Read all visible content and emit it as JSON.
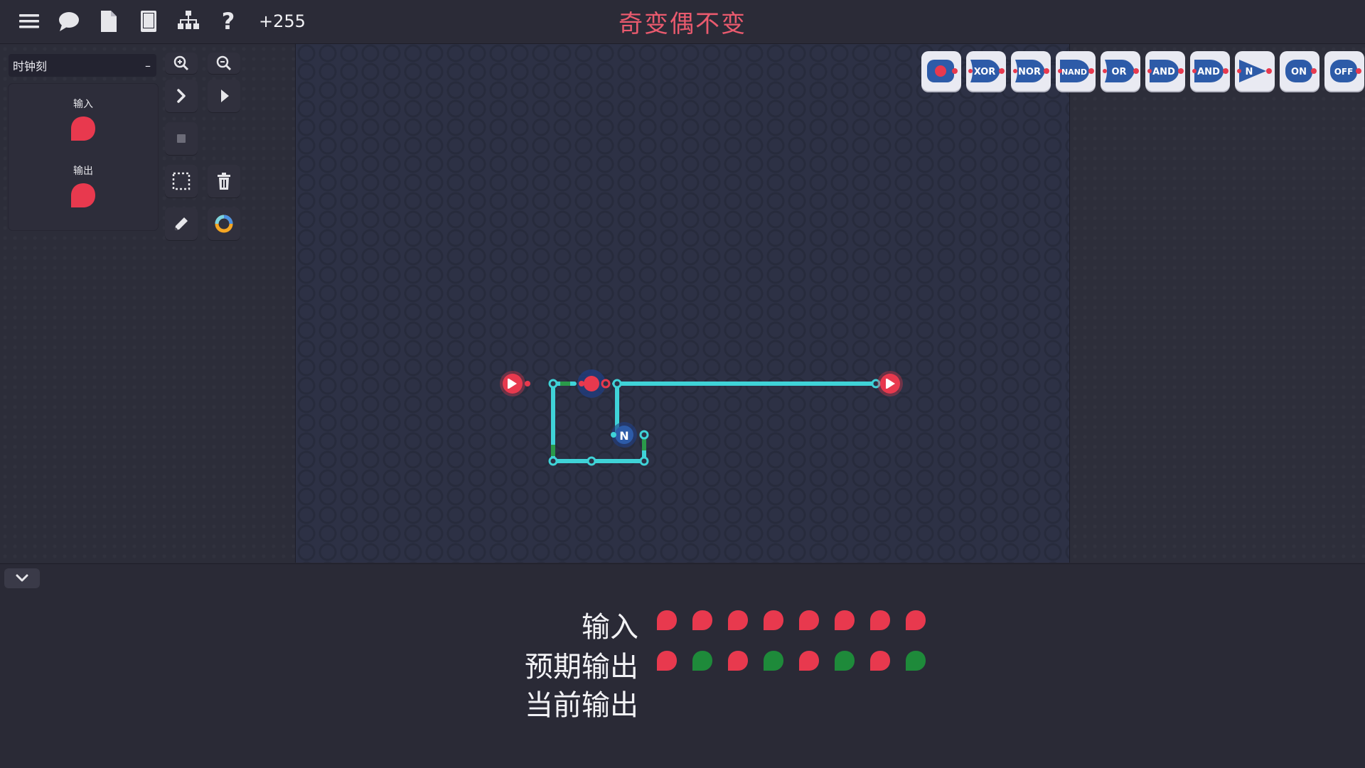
{
  "topbar": {
    "score": "+255",
    "title": "奇变偶不变",
    "icons": [
      "menu-icon",
      "chat-icon",
      "document-icon",
      "book-icon",
      "hierarchy-icon",
      "help-icon"
    ]
  },
  "sidebar": {
    "clock_select": {
      "value": "时钟刻",
      "collapse_symbol": "–"
    },
    "io": {
      "input_label": "输入",
      "output_label": "输出"
    },
    "tools": [
      "zoom-in",
      "zoom-out",
      "step",
      "play",
      "stop",
      "select",
      "delete",
      "pencil",
      "color-wheel"
    ]
  },
  "palette": {
    "chips": [
      {
        "name": "input-node",
        "label": ""
      },
      {
        "name": "xor-gate",
        "label": "XOR"
      },
      {
        "name": "nor-gate",
        "label": "NOR"
      },
      {
        "name": "nand-gate",
        "label": "NAND"
      },
      {
        "name": "or-gate",
        "label": "OR"
      },
      {
        "name": "and-gate",
        "label": "AND"
      },
      {
        "name": "and-gate-2",
        "label": "AND"
      },
      {
        "name": "not-gate",
        "label": "N"
      },
      {
        "name": "on-switch",
        "label": "ON"
      },
      {
        "name": "off-switch",
        "label": "OFF"
      }
    ]
  },
  "circuit": {
    "not_label": "N"
  },
  "results": {
    "input_label": "输入",
    "expected_label": "预期输出",
    "current_label": "当前输出",
    "inputs": [
      0,
      0,
      0,
      0,
      0,
      0,
      0,
      0
    ],
    "expected": [
      0,
      1,
      0,
      1,
      0,
      1,
      0,
      1
    ],
    "current": []
  },
  "colors": {
    "off": "#e8394e",
    "on": "#1e8a3a",
    "wire": "#3fd3d8",
    "title": "#ea5a6e",
    "node_blue": "#2d5ba8"
  }
}
